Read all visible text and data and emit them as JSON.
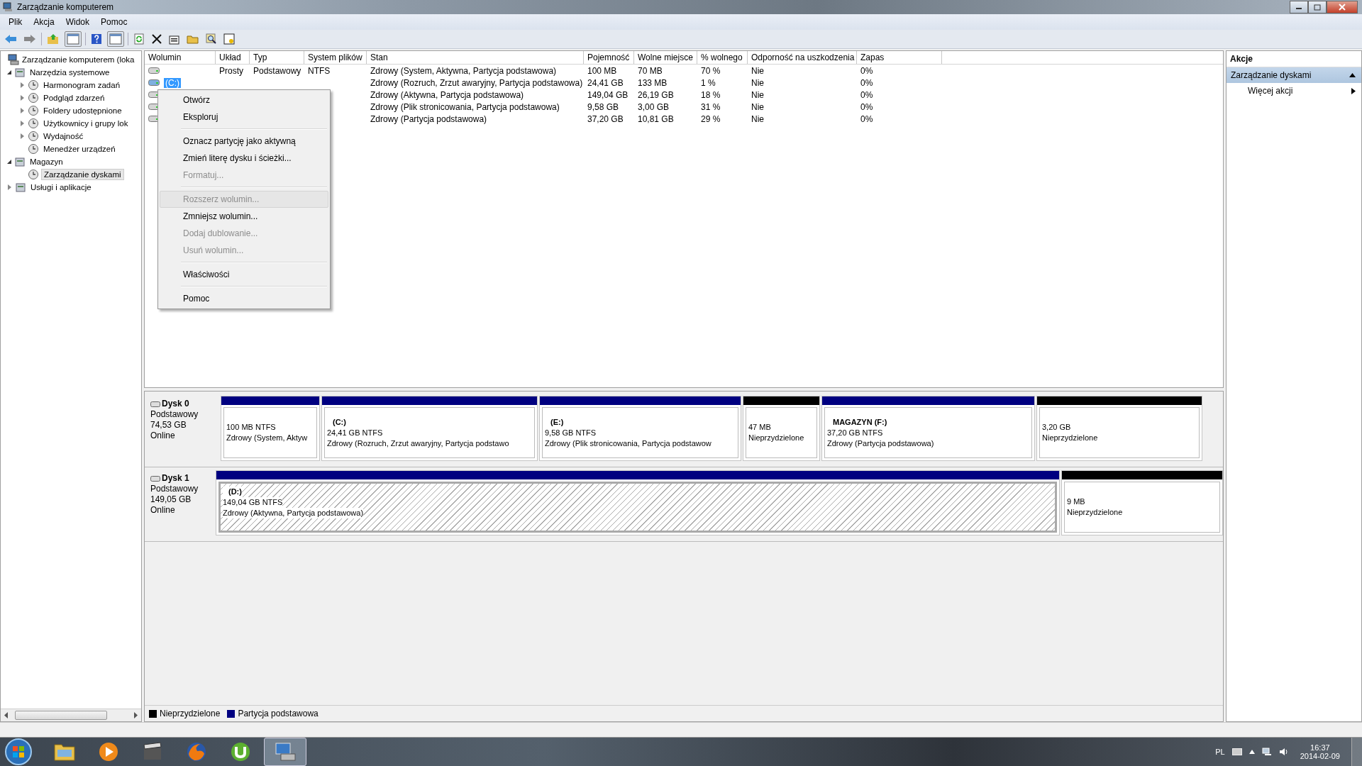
{
  "window": {
    "title": "Zarządzanie komputerem"
  },
  "menu": [
    "Plik",
    "Akcja",
    "Widok",
    "Pomoc"
  ],
  "tree": {
    "label": "Zarządzanie komputerem (loka",
    "children": [
      {
        "label": "Narzędzia systemowe",
        "expanded": true,
        "selected": false,
        "children": [
          {
            "label": "Harmonogram zadań",
            "expanded": false,
            "selected": false
          },
          {
            "label": "Podgląd zdarzeń",
            "expanded": false,
            "selected": false
          },
          {
            "label": "Foldery udostępnione",
            "expanded": false,
            "selected": false
          },
          {
            "label": "Użytkownicy i grupy lok",
            "expanded": false,
            "selected": false
          },
          {
            "label": "Wydajność",
            "expanded": false,
            "selected": false
          },
          {
            "label": "Menedżer urządzeń",
            "selected": false
          }
        ]
      },
      {
        "label": "Magazyn",
        "expanded": true,
        "selected": false,
        "children": [
          {
            "label": "Zarządzanie dyskami",
            "selected": true
          }
        ]
      },
      {
        "label": "Usługi i aplikacje",
        "expanded": false,
        "selected": false
      }
    ]
  },
  "table": {
    "columns": [
      "Wolumin",
      "Układ",
      "Typ",
      "System plików",
      "Stan",
      "Pojemność",
      "Wolne miejsce",
      "% wolnego",
      "Odporność na uszkodzenia",
      "Zapas"
    ],
    "rows": [
      {
        "selected": false,
        "cells": [
          "",
          "Prosty",
          "Podstawowy",
          "NTFS",
          "Zdrowy (System, Aktywna, Partycja podstawowa)",
          "100 MB",
          "70 MB",
          "70 %",
          "Nie",
          "0%"
        ]
      },
      {
        "selected": true,
        "cells": [
          "(C:)",
          "",
          "",
          "",
          "Zdrowy (Rozruch, Zrzut awaryjny, Partycja podstawowa)",
          "24,41 GB",
          "133 MB",
          "1 %",
          "Nie",
          "0%"
        ]
      },
      {
        "selected": false,
        "cells": [
          "",
          "",
          "",
          "",
          "Zdrowy (Aktywna, Partycja podstawowa)",
          "149,04 GB",
          "26,19 GB",
          "18 %",
          "Nie",
          "0%"
        ]
      },
      {
        "selected": false,
        "cells": [
          "",
          "",
          "",
          "",
          "Zdrowy (Plik stronicowania, Partycja podstawowa)",
          "9,58 GB",
          "3,00 GB",
          "31 %",
          "Nie",
          "0%"
        ]
      },
      {
        "selected": false,
        "cells": [
          "",
          "",
          "",
          "",
          "Zdrowy (Partycja podstawowa)",
          "37,20 GB",
          "10,81 GB",
          "29 %",
          "Nie",
          "0%"
        ]
      }
    ]
  },
  "context_menu": [
    {
      "kind": "item",
      "label": "Otwórz",
      "disabled": false,
      "selected": false
    },
    {
      "kind": "item",
      "label": "Eksploruj",
      "disabled": false,
      "selected": false
    },
    {
      "kind": "separator"
    },
    {
      "kind": "item",
      "label": "Oznacz partycję jako aktywną",
      "disabled": false,
      "selected": false
    },
    {
      "kind": "item",
      "label": "Zmień literę dysku i ścieżki...",
      "disabled": false,
      "selected": false
    },
    {
      "kind": "item",
      "label": "Formatuj...",
      "disabled": true,
      "selected": false
    },
    {
      "kind": "separator"
    },
    {
      "kind": "item",
      "label": "Rozszerz wolumin...",
      "disabled": true,
      "selected": true
    },
    {
      "kind": "item",
      "label": "Zmniejsz wolumin...",
      "disabled": false,
      "selected": false
    },
    {
      "kind": "item",
      "label": "Dodaj dublowanie...",
      "disabled": true,
      "selected": false
    },
    {
      "kind": "item",
      "label": "Usuń wolumin...",
      "disabled": true,
      "selected": false
    },
    {
      "kind": "separator"
    },
    {
      "kind": "item",
      "label": "Właściwości",
      "disabled": false,
      "selected": false
    },
    {
      "kind": "separator"
    },
    {
      "kind": "item",
      "label": "Pomoc",
      "disabled": false,
      "selected": false
    }
  ],
  "disks": [
    {
      "name": "Dysk 0",
      "type": "Podstawowy",
      "size": "74,53 GB",
      "status": "Online",
      "partitions": [
        {
          "kind": "primary",
          "selected": false,
          "size": "100 MB NTFS",
          "state": "Zdrowy (System, Aktyw"
        },
        {
          "kind": "primary",
          "selected": false,
          "label": "(C:)",
          "size": "24,41 GB NTFS",
          "state": "Zdrowy (Rozruch, Zrzut awaryjny, Partycja podstawo"
        },
        {
          "kind": "primary",
          "selected": false,
          "label": "(E:)",
          "size": "9,58 GB NTFS",
          "state": "Zdrowy (Plik stronicowania, Partycja podstawow"
        },
        {
          "kind": "unallocated",
          "selected": false,
          "size": "47 MB",
          "state": "Nieprzydzielone"
        },
        {
          "kind": "primary",
          "selected": false,
          "label": "MAGAZYN  (F:)",
          "size": "37,20 GB NTFS",
          "state": "Zdrowy (Partycja podstawowa)"
        },
        {
          "kind": "unallocated",
          "selected": false,
          "size": "3,20 GB",
          "state": "Nieprzydzielone"
        }
      ]
    },
    {
      "name": "Dysk 1",
      "type": "Podstawowy",
      "size": "149,05 GB",
      "status": "Online",
      "partitions": [
        {
          "kind": "primary",
          "selected": true,
          "label": "(D:)",
          "size": "149,04 GB NTFS",
          "state": "Zdrowy (Aktywna, Partycja podstawowa)"
        },
        {
          "kind": "unallocated",
          "selected": false,
          "size": "9 MB",
          "state": "Nieprzydzielone"
        }
      ]
    }
  ],
  "legend": [
    {
      "label": "Nieprzydzielone",
      "color": "#000000"
    },
    {
      "label": "Partycja podstawowa",
      "color": "#000080"
    }
  ],
  "actions": {
    "title": "Akcje",
    "section": "Zarządzanie dyskami",
    "items": [
      "Więcej akcji"
    ]
  },
  "taskbar": {
    "language": "PL",
    "time": "16:37",
    "date": "2014-02-09"
  }
}
